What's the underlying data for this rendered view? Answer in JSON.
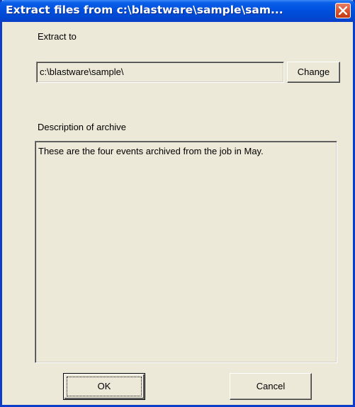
{
  "dialog": {
    "title": "Extract files from c:\\blastware\\sample\\sam...",
    "close_icon": "close-icon"
  },
  "extract_to": {
    "label": "Extract to",
    "value": "c:\\blastware\\sample\\",
    "change_label": "Change"
  },
  "description": {
    "label": "Description of archive",
    "value": "These are the four events archived from the job in May."
  },
  "buttons": {
    "ok_label": "OK",
    "cancel_label": "Cancel"
  },
  "colors": {
    "titlebar": "#0052e0",
    "close_button": "#d9542f",
    "dialog_background": "#ece9d8"
  }
}
